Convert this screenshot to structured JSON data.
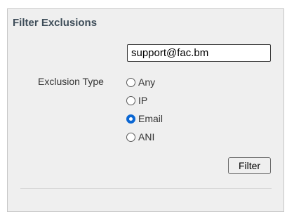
{
  "panel": {
    "title": "Filter Exclusions",
    "search": {
      "value": "support@fac.bm",
      "placeholder": ""
    },
    "exclusion_type": {
      "label": "Exclusion Type",
      "options": [
        {
          "label": "Any",
          "checked": false
        },
        {
          "label": "IP",
          "checked": false
        },
        {
          "label": "Email",
          "checked": true
        },
        {
          "label": "ANI",
          "checked": false
        }
      ]
    },
    "filter_label": "Filter"
  },
  "colors": {
    "accent": "#0b67d3",
    "title": "#3e4d59",
    "panel_bg": "#efefef"
  }
}
